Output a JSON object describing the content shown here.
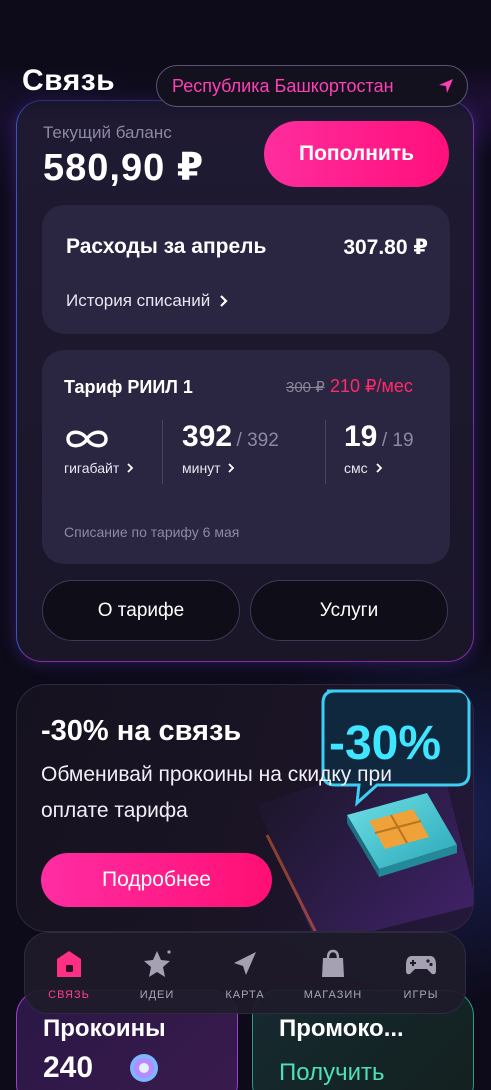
{
  "header": {
    "title": "Связь",
    "region": "Республика Башкортостан"
  },
  "balance": {
    "label": "Текущий баланс",
    "value": "580,90 ₽",
    "topup_label": "Пополнить"
  },
  "expenses": {
    "title": "Расходы за апрель",
    "amount": "307.80 ₽",
    "history_link": "История списаний"
  },
  "tariff": {
    "name": "Тариф РИИЛ 1",
    "price_old": "300 ₽",
    "price_new": "210 ₽/мес",
    "stats": [
      {
        "value": "∞",
        "total": "",
        "label": "гигабайт"
      },
      {
        "value": "392",
        "total": "/ 392",
        "label": "минут"
      },
      {
        "value": "19",
        "total": "/ 19",
        "label": "смс"
      }
    ],
    "note": "Списание по тарифу 6 мая",
    "about_label": "О тарифе",
    "services_label": "Услуги"
  },
  "promo": {
    "title": "-30% на связь",
    "text": "Обменивай прокоины на скидку при оплате тарифа",
    "button_label": "Подробнее",
    "badge": "-30%"
  },
  "cards": {
    "coins_title": "Прокоины",
    "coins_value": "240",
    "promo_title": "Промоко...",
    "promo_action": "Получить"
  },
  "tabs": [
    {
      "label": "СВЯЗЬ",
      "icon": "home-icon",
      "active": true
    },
    {
      "label": "ИДЕИ",
      "icon": "star-icon",
      "active": false
    },
    {
      "label": "КАРТА",
      "icon": "map-arrow-icon",
      "active": false
    },
    {
      "label": "МАГАЗИН",
      "icon": "shopping-bag-icon",
      "active": false
    },
    {
      "label": "ИГРЫ",
      "icon": "gamepad-icon",
      "active": false
    }
  ],
  "colors": {
    "accent": "#ff1f8e",
    "price_new": "#ff2a6a",
    "region_text": "#ff3fb5",
    "background": "#0d0b1a"
  }
}
